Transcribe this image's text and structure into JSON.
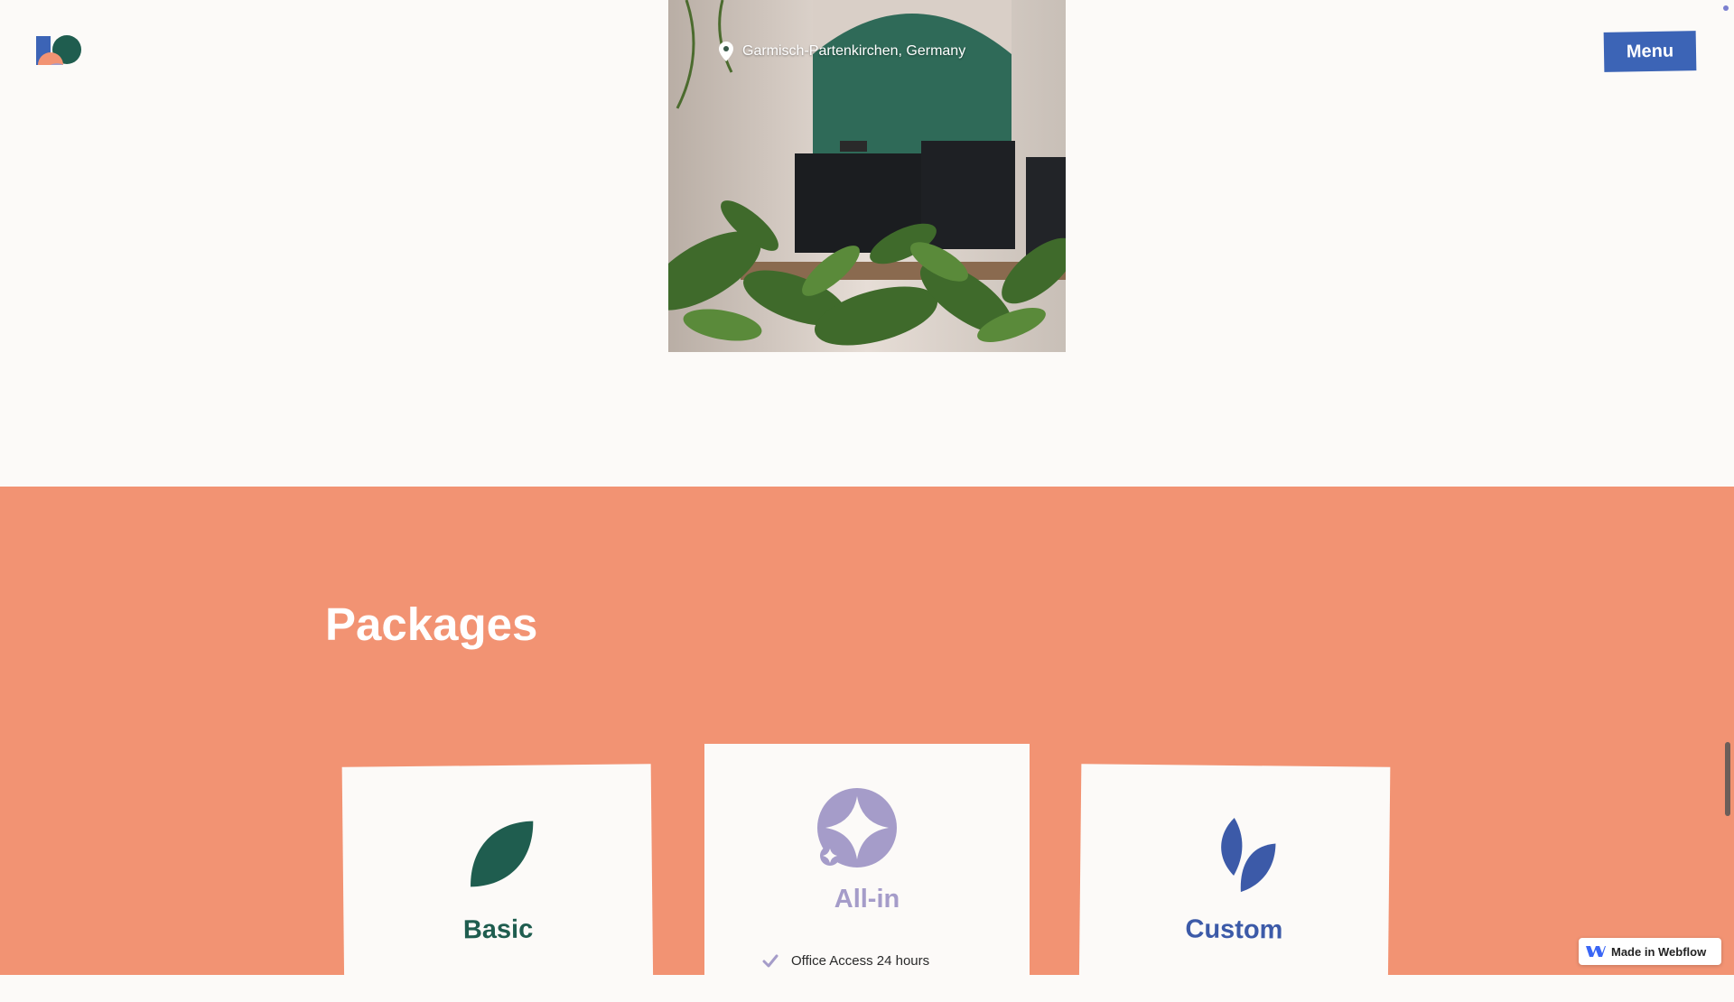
{
  "header": {
    "logo_alt": "",
    "menu_label": "Menu"
  },
  "hero": {
    "location": "Garmisch-Partenkirchen, Germany"
  },
  "packages": {
    "title": "Packages",
    "cards": [
      {
        "title": "Basic",
        "icon": "leaf-icon"
      },
      {
        "title": "All-in",
        "icon": "sparkle-icon",
        "features": [
          "Office Access 24 hours"
        ]
      },
      {
        "title": "Custom",
        "icon": "two-leaves-icon"
      }
    ]
  },
  "badge": {
    "label": "Made in Webflow"
  },
  "colors": {
    "section_bg": "#f29373",
    "page_bg": "#fcfaf8",
    "menu_btn": "#3c64b6",
    "basic": "#1f5d4f",
    "allin": "#a59cc9",
    "custom": "#3c5aa8"
  }
}
